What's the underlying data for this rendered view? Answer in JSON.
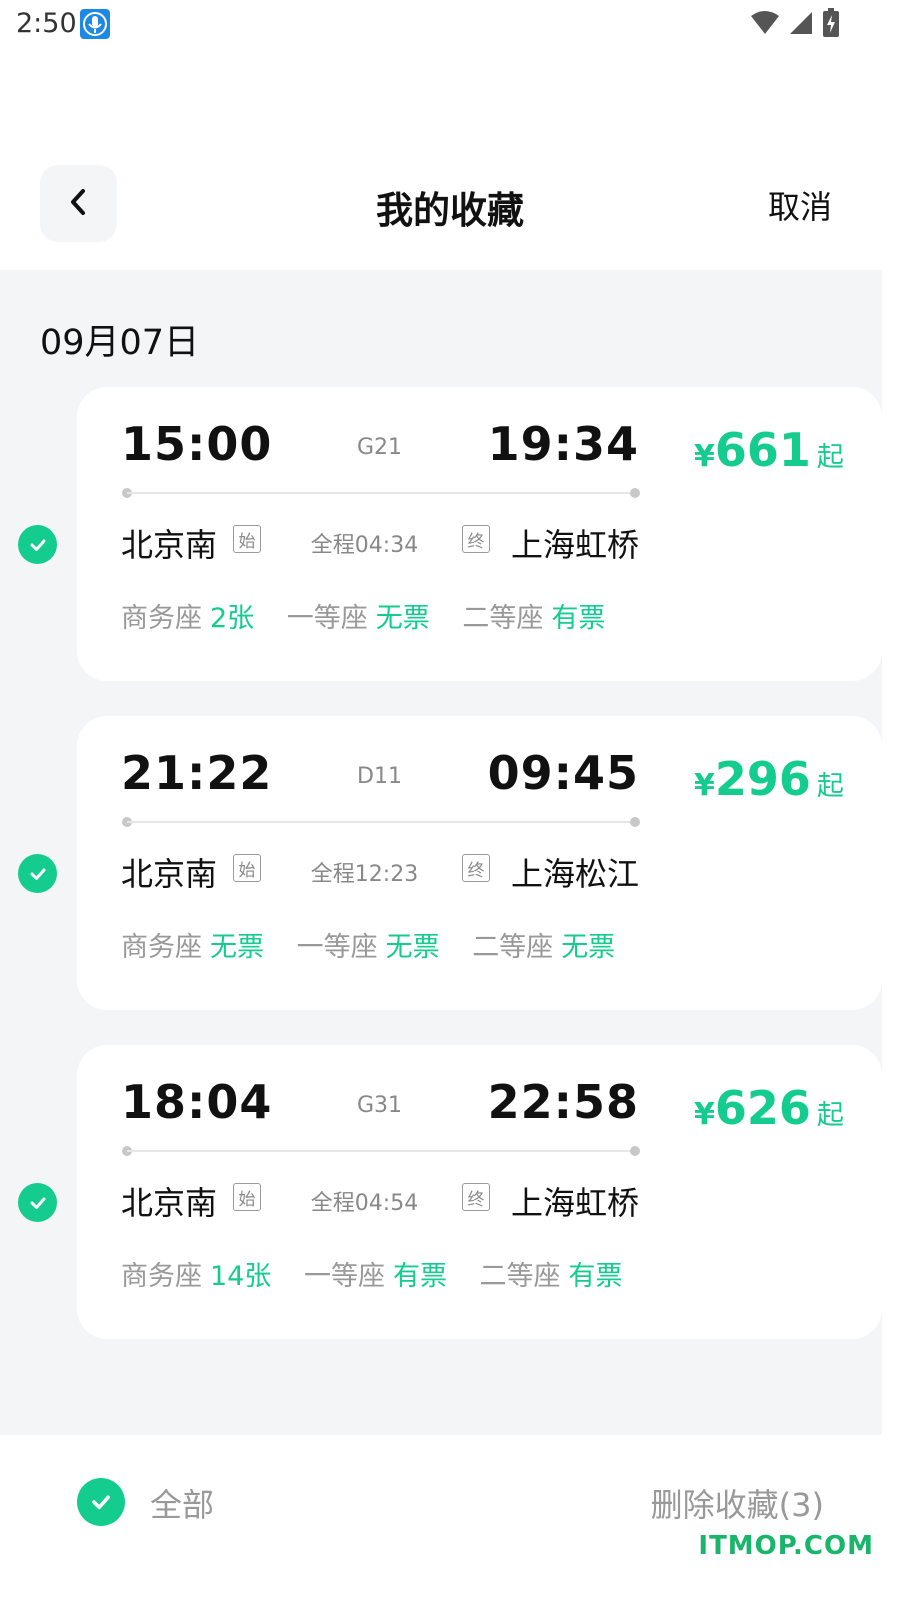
{
  "status_bar": {
    "time": "2:50"
  },
  "nav": {
    "title": "我的收藏",
    "cancel": "取消"
  },
  "date": "09月07日",
  "trains": [
    {
      "depart": "15:00",
      "number": "G21",
      "arrive": "19:34",
      "price_symbol": "¥",
      "price": "661",
      "price_suffix": "起",
      "from": "北京南",
      "from_tag": "始",
      "duration": "全程04:34",
      "to_tag": "终",
      "to": "上海虹桥",
      "seats": [
        {
          "label": "商务座",
          "value": "2张"
        },
        {
          "label": "一等座",
          "value": "无票"
        },
        {
          "label": "二等座",
          "value": "有票"
        }
      ]
    },
    {
      "depart": "21:22",
      "number": "D11",
      "arrive": "09:45",
      "price_symbol": "¥",
      "price": "296",
      "price_suffix": "起",
      "from": "北京南",
      "from_tag": "始",
      "duration": "全程12:23",
      "to_tag": "终",
      "to": "上海松江",
      "seats": [
        {
          "label": "商务座",
          "value": "无票"
        },
        {
          "label": "一等座",
          "value": "无票"
        },
        {
          "label": "二等座",
          "value": "无票"
        }
      ]
    },
    {
      "depart": "18:04",
      "number": "G31",
      "arrive": "22:58",
      "price_symbol": "¥",
      "price": "626",
      "price_suffix": "起",
      "from": "北京南",
      "from_tag": "始",
      "duration": "全程04:54",
      "to_tag": "终",
      "to": "上海虹桥",
      "seats": [
        {
          "label": "商务座",
          "value": "14张"
        },
        {
          "label": "一等座",
          "value": "有票"
        },
        {
          "label": "二等座",
          "value": "有票"
        }
      ]
    }
  ],
  "footer": {
    "select_all": "全部",
    "delete": "删除收藏(3)"
  },
  "watermark": "ITMOP.COM",
  "colors": {
    "accent": "#14cc8d",
    "page_bg": "#f4f5f7",
    "muted_text": "#999999"
  },
  "icons": [
    "back-arrow-icon",
    "check-circle-icon",
    "mic-icon",
    "wifi-icon",
    "signal-icon",
    "battery-icon"
  ]
}
